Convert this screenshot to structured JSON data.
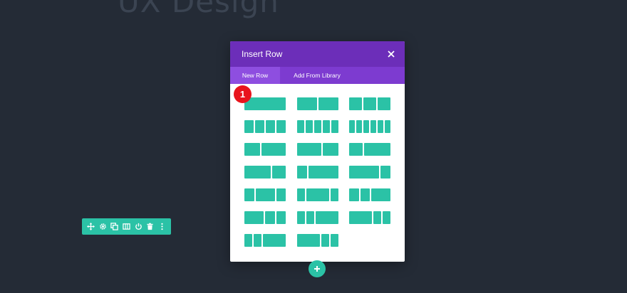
{
  "page": {
    "background_heading": "UX Design"
  },
  "modal": {
    "title": "Insert Row",
    "tabs": [
      {
        "label": "New Row",
        "active": true
      },
      {
        "label": "Add From Library",
        "active": false
      }
    ]
  },
  "badge": {
    "number": "1"
  },
  "row_toolbar": {
    "icons": [
      "move-icon",
      "gear-icon",
      "duplicate-icon",
      "columns-icon",
      "power-icon",
      "trash-icon",
      "more-icon"
    ]
  },
  "row_layouts": [
    {
      "name": "1",
      "columns": [
        1
      ]
    },
    {
      "name": "1/2 + 1/2",
      "columns": [
        1,
        1
      ]
    },
    {
      "name": "1/3 x 3",
      "columns": [
        1,
        1,
        1
      ]
    },
    {
      "name": "1/4 x 4",
      "columns": [
        1,
        1,
        1,
        1
      ]
    },
    {
      "name": "1/5 x 5",
      "columns": [
        1,
        1,
        1,
        1,
        1
      ]
    },
    {
      "name": "1/6 x 6",
      "columns": [
        1,
        1,
        1,
        1,
        1,
        1
      ]
    },
    {
      "name": "2/5 + 3/5",
      "columns": [
        2,
        3
      ]
    },
    {
      "name": "3/5 + 2/5",
      "columns": [
        3,
        2
      ]
    },
    {
      "name": "1/3 + 2/3",
      "columns": [
        1,
        2
      ]
    },
    {
      "name": "2/3 + 1/3",
      "columns": [
        2,
        1
      ]
    },
    {
      "name": "1/4 + 3/4",
      "columns": [
        1,
        3
      ]
    },
    {
      "name": "3/4 + 1/4",
      "columns": [
        3,
        1
      ]
    },
    {
      "name": "1/4 + 1/2 + 1/4",
      "columns": [
        1,
        2,
        1
      ]
    },
    {
      "name": "1/5 + 3/5 + 1/5",
      "columns": [
        1,
        3,
        1
      ]
    },
    {
      "name": "1/4 + 1/4 + 1/2",
      "columns": [
        1,
        1,
        2
      ]
    },
    {
      "name": "1/2 + 1/4 + 1/4",
      "columns": [
        2,
        1,
        1
      ]
    },
    {
      "name": "1/5 + 1/5 + 3/5",
      "columns": [
        1,
        1,
        3
      ]
    },
    {
      "name": "3/5 + 1/5 + 1/5",
      "columns": [
        3,
        1,
        1
      ]
    },
    {
      "name": "1/6 + 1/6 + 1/2",
      "columns": [
        1,
        1,
        3
      ]
    },
    {
      "name": "1/2 + 1/6 + 1/6",
      "columns": [
        3,
        1,
        1
      ]
    }
  ]
}
